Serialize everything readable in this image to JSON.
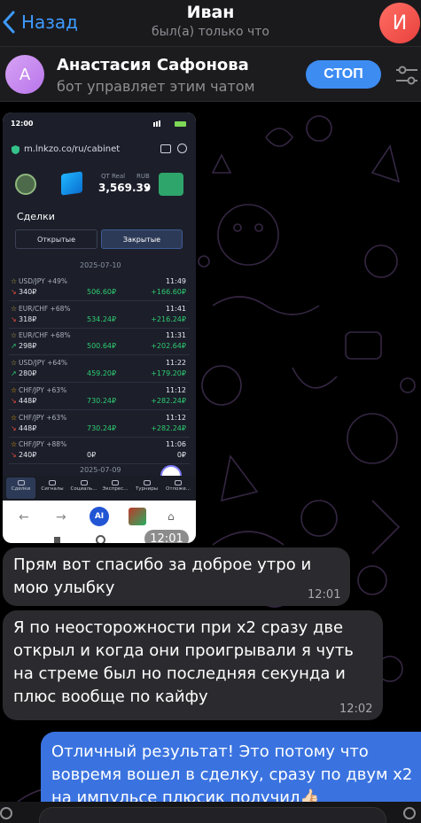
{
  "header": {
    "back_label": "Назад",
    "title": "Иван",
    "status": "был(а) только что",
    "avatar_letter": "И"
  },
  "bot_bar": {
    "avatar_letter": "А",
    "name": "Анастасия Сафонова",
    "subtitle": "бот управляет этим чатом",
    "stop_label": "СТОП"
  },
  "screenshot": {
    "status_time": "12:00",
    "url": "m.lnkzo.co/ru/cabinet",
    "account_label": "QT Real",
    "currency_label": "RUB",
    "balance": "3,569.39",
    "section_title": "Сделки",
    "tab_open": "Открытые",
    "tab_closed": "Закрытые",
    "date1": "2025-07-10",
    "date2": "2025-07-09",
    "trades": [
      {
        "pair": "USD/JPY +49%",
        "amount": "340₽",
        "price": "506.60₽",
        "time": "11:49",
        "profit": "+166.60₽"
      },
      {
        "pair": "EUR/CHF +68%",
        "amount": "318₽",
        "price": "534.24₽",
        "time": "11:41",
        "profit": "+216.24₽"
      },
      {
        "pair": "EUR/CHF +68%",
        "amount": "298₽",
        "price": "500.64₽",
        "time": "11:31",
        "profit": "+202.64₽"
      },
      {
        "pair": "USD/JPY +64%",
        "amount": "280₽",
        "price": "459.20₽",
        "time": "11:22",
        "profit": "+179.20₽"
      },
      {
        "pair": "CHF/JPY +63%",
        "amount": "448₽",
        "price": "730.24₽",
        "time": "11:12",
        "profit": "+282.24₽"
      },
      {
        "pair": "CHF/JPY +63%",
        "amount": "448₽",
        "price": "730.24₽",
        "time": "11:12",
        "profit": "+282.24₽"
      },
      {
        "pair": "CHF/JPY +88%",
        "amount": "240₽",
        "price": "0₽",
        "time": "11:06",
        "profit": "0₽"
      }
    ],
    "nav": [
      "Сделки",
      "Сигналы",
      "Социаль...",
      "Экспрес...",
      "Турниры",
      "Отложе..."
    ],
    "browser_ai": "AI",
    "time_badge": "12:01"
  },
  "messages": [
    {
      "text": "Прям вот спасибо за доброе утро и мою улыбку",
      "time": "12:01"
    },
    {
      "text": "Я по неосторожности при х2 сразу две открыл и когда они проигрывали я чуть на стреме был но последняя секунда и плюс вообще по кайфу",
      "time": "12:02"
    }
  ],
  "outgoing": {
    "text": "Отличный результат! Это потому что вовремя вошел в сделку, сразу по двум х2 на импульсе плюсик получил👍🏻"
  },
  "colors": {
    "accent": "#3e9bff",
    "stop": "#3d8cf2",
    "outgoing": "#3a73e0",
    "win": "#2ecc71",
    "loss": "#e74c3c"
  }
}
